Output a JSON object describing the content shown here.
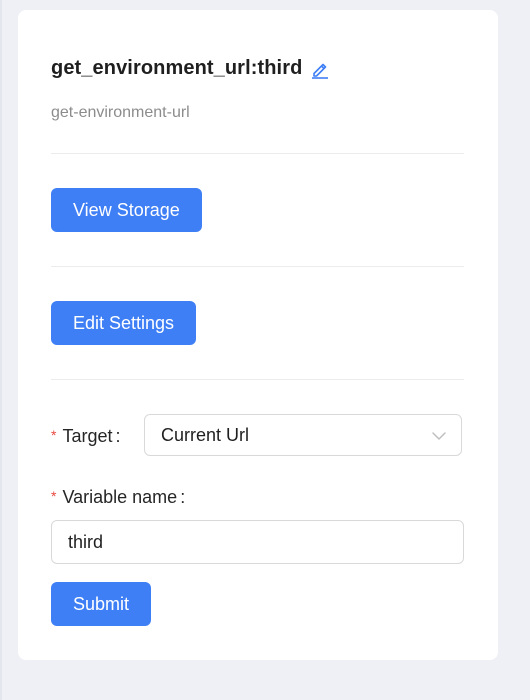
{
  "header": {
    "title": "get_environment_url:third",
    "subtitle": "get-environment-url",
    "edit_icon": "pencil-icon"
  },
  "actions": {
    "view_storage_label": "View Storage",
    "edit_settings_label": "Edit Settings"
  },
  "form": {
    "target": {
      "required_mark": "*",
      "label": "Target",
      "colon": ":",
      "selected": "Current Url",
      "dropdown_icon": "chevron-down-icon"
    },
    "variable_name": {
      "required_mark": "*",
      "label": "Variable name",
      "colon": ":",
      "value": "third"
    },
    "submit_label": "Submit"
  },
  "colors": {
    "primary": "#3f7ff5",
    "required": "#e8473f",
    "muted_text": "#8c8c8c",
    "background": "#eef0f5"
  }
}
